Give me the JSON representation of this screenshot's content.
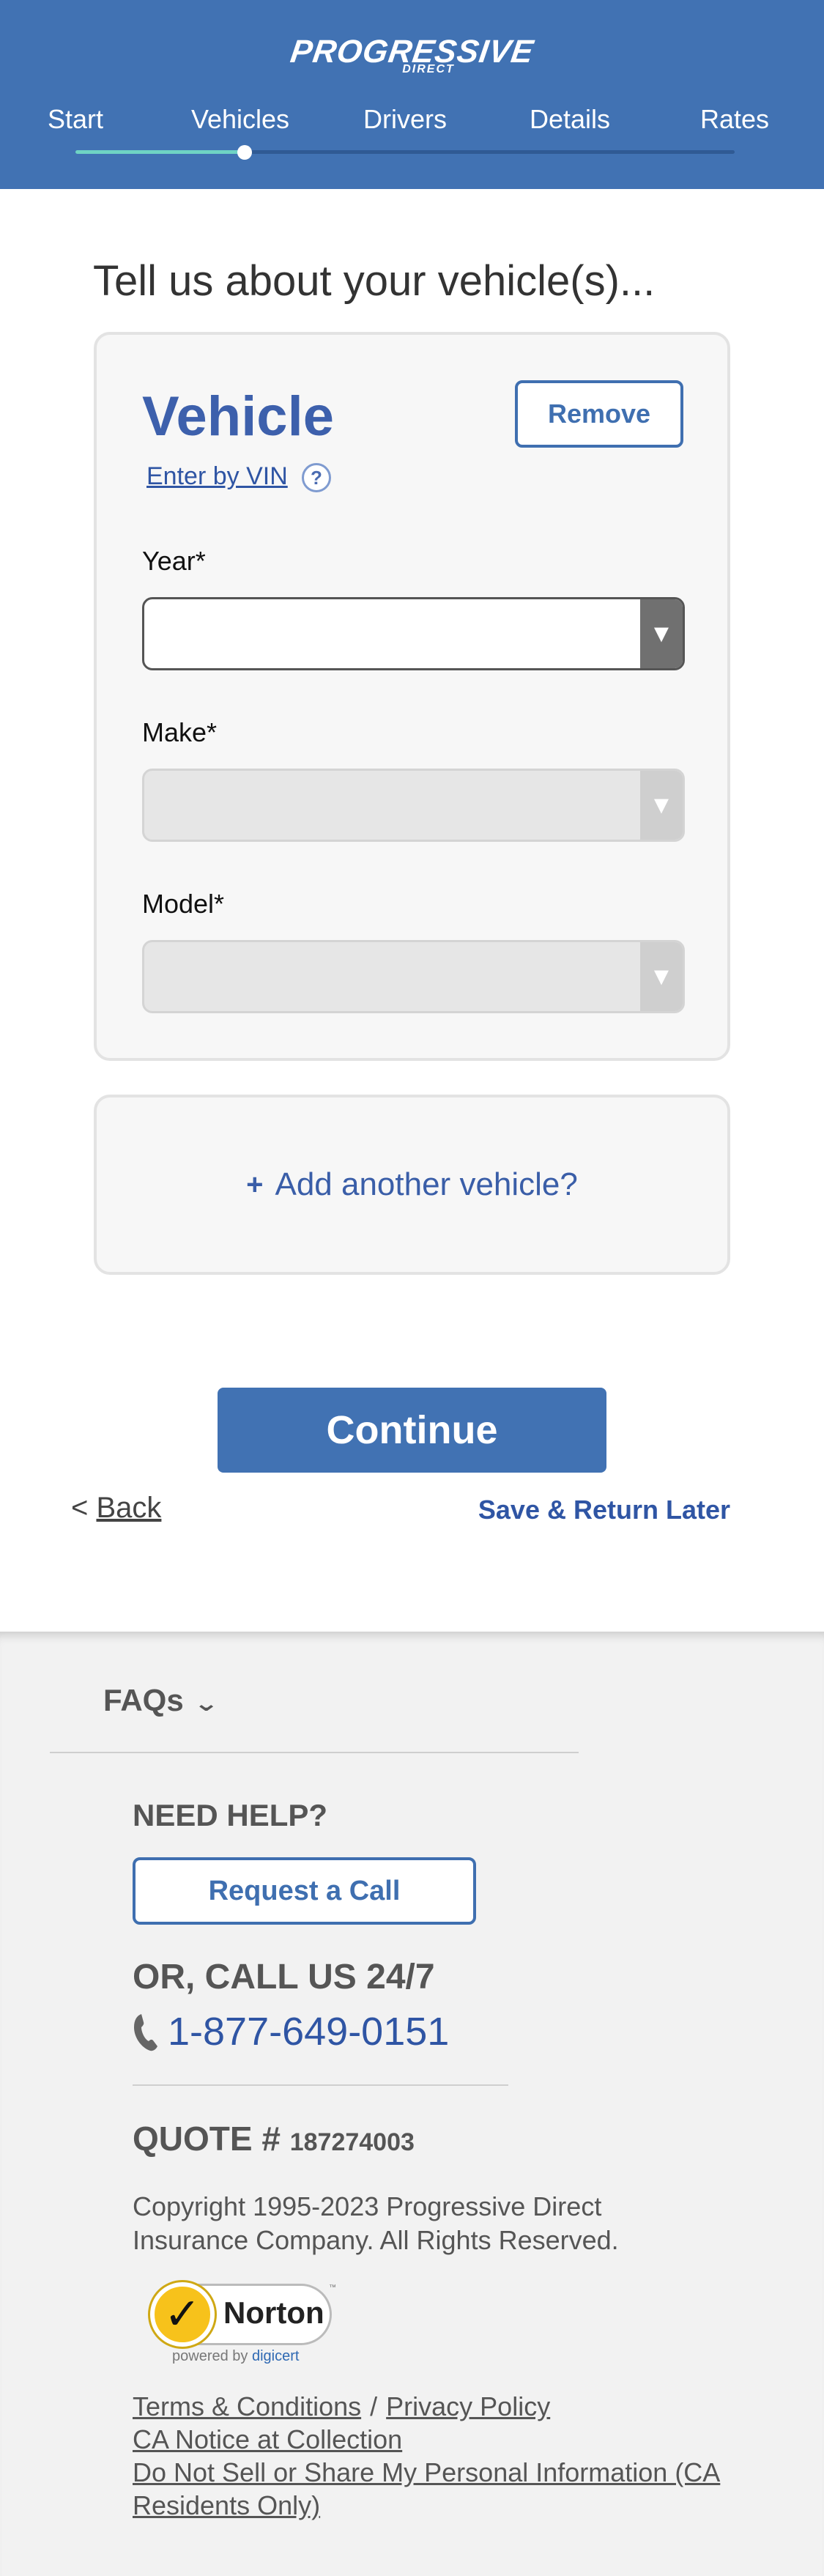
{
  "header": {
    "brand": "PROGRESSIVE",
    "brand_sub": "DIRECT",
    "steps": [
      "Start",
      "Vehicles",
      "Drivers",
      "Details",
      "Rates"
    ],
    "current_step": "Vehicles",
    "progress_fraction": 0.26
  },
  "main": {
    "heading": "Tell us about your vehicle(s)...",
    "vehicle_card": {
      "title": "Vehicle",
      "remove_label": "Remove",
      "vin_link": "Enter by VIN",
      "vin_help": "?",
      "fields": [
        {
          "label": "Year*",
          "value": "",
          "state": "enabled"
        },
        {
          "label": "Make*",
          "value": "",
          "state": "disabled"
        },
        {
          "label": "Model*",
          "value": "",
          "state": "disabled"
        }
      ]
    },
    "add_vehicle": {
      "plus": "+",
      "label": "Add another vehicle?"
    },
    "continue_label": "Continue",
    "back_prefix": "<",
    "back_label": "Back",
    "save_label": "Save & Return Later"
  },
  "footer": {
    "faqs_label": "FAQs",
    "need_help": "NEED HELP?",
    "request_call": "Request a Call",
    "or_call": "OR, CALL US 24/7",
    "phone": "1-877-649-0151",
    "quote_label": "QUOTE #",
    "quote_number": "187274003",
    "copyright": "Copyright 1995-2023 Progressive Direct Insurance Company. All Rights Reserved.",
    "norton": {
      "word": "Norton",
      "tm": "™",
      "powered": "powered by",
      "digicert": "digicert"
    },
    "links": {
      "terms": "Terms & Conditions",
      "separator": "/",
      "privacy": "Privacy Policy",
      "ca_notice": "CA Notice at Collection",
      "do_not_sell": "Do Not Sell or Share My Personal Information (CA Residents Only)"
    }
  },
  "colors": {
    "brand_blue": "#4172b3",
    "link_blue": "#2f55a4",
    "progress_teal": "#6fd3c4",
    "footer_bg": "#f2f2f2"
  },
  "icons": [
    "help-icon",
    "dropdown-arrow-icon",
    "plus-icon",
    "chevron-down-icon",
    "phone-icon",
    "norton-checkmark-icon"
  ]
}
